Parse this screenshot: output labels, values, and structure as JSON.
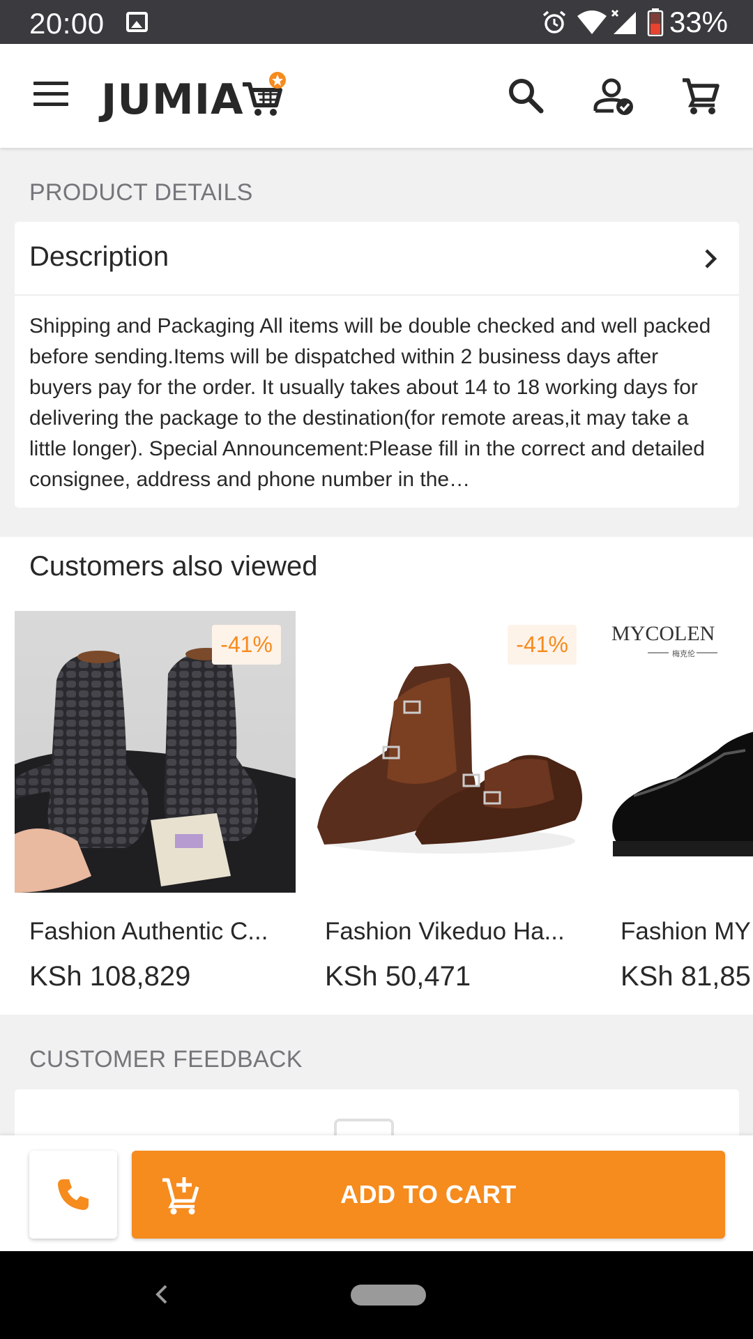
{
  "status_bar": {
    "time": "20:00",
    "battery_percent": "33%",
    "icons": [
      "image-icon",
      "alarm-icon",
      "wifi-icon",
      "cell-signal-icon",
      "battery-icon"
    ]
  },
  "header": {
    "logo_text": "JUMIA",
    "icons": [
      "menu-icon",
      "search-icon",
      "account-icon",
      "cart-icon"
    ]
  },
  "product_details": {
    "section_label": "PRODUCT DETAILS",
    "description_title": "Description",
    "description_text": "Shipping and Packaging All items will be double checked and well packed before sending.Items will be dispatched within 2 business days after buyers pay for the order. It usually takes about 14 to 18 working days for delivering the package to the destination(for remote areas,it may take a little longer). Special Announcement:Please fill in the correct and detailed consignee, address and phone number in the…"
  },
  "customers_also_viewed": {
    "title": "Customers also viewed",
    "products": [
      {
        "name": "Fashion Authentic C...",
        "price": "KSh 108,829",
        "discount": "-41%"
      },
      {
        "name": "Fashion Vikeduo Ha...",
        "price": "KSh 50,471",
        "discount": "-41%"
      },
      {
        "name": "Fashion MY",
        "price": "KSh 81,85",
        "brand_text": "MYCOLEN",
        "brand_sub": "梅克伦"
      }
    ]
  },
  "customer_feedback": {
    "section_label": "CUSTOMER FEEDBACK"
  },
  "action_bar": {
    "add_to_cart_label": "ADD TO CART"
  },
  "colors": {
    "accent": "#f68b1e",
    "status_bar": "#3a3a3f",
    "background": "#f1f1f2"
  }
}
